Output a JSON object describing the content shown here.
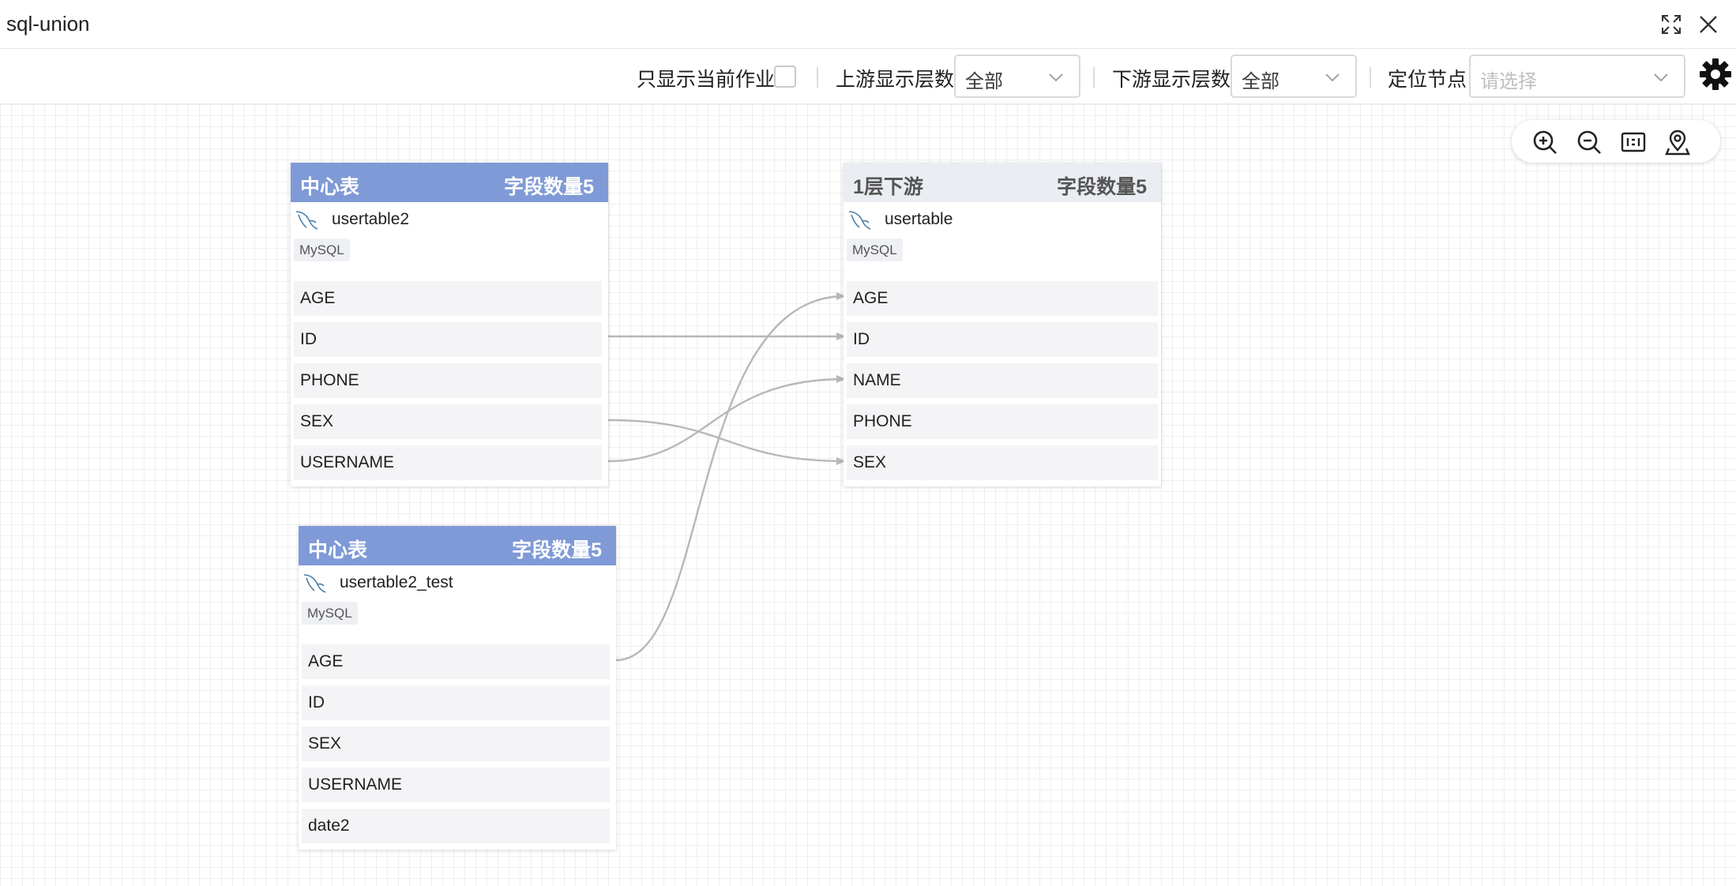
{
  "window": {
    "title": "sql-union"
  },
  "toolbar": {
    "only_current_job_label": "只显示当前作业",
    "upstream_label": "上游显示层数",
    "upstream_value": "全部",
    "downstream_label": "下游显示层数",
    "downstream_value": "全部",
    "locate_label": "定位节点",
    "locate_placeholder": "请选择"
  },
  "nodes": {
    "center1": {
      "type_label": "中心表",
      "count_label": "字段数量5",
      "name": "usertable2",
      "db": "MySQL",
      "fields": [
        "AGE",
        "ID",
        "PHONE",
        "SEX",
        "USERNAME"
      ]
    },
    "center2": {
      "type_label": "中心表",
      "count_label": "字段数量5",
      "name": "usertable2_test",
      "db": "MySQL",
      "fields": [
        "AGE",
        "ID",
        "SEX",
        "USERNAME",
        "date2"
      ]
    },
    "down1": {
      "type_label": "1层下游",
      "count_label": "字段数量5",
      "name": "usertable",
      "db": "MySQL",
      "fields": [
        "AGE",
        "ID",
        "NAME",
        "PHONE",
        "SEX"
      ]
    }
  },
  "icons": {
    "expand": "expand-icon",
    "close": "close-icon",
    "settings": "gear-icon",
    "zoom_in": "zoom-in-icon",
    "zoom_out": "zoom-out-icon",
    "fit": "fit-view-icon",
    "locate": "locate-pin-icon",
    "db": "mysql-dolphin-icon"
  },
  "colors": {
    "center_header": "#7f9ad6",
    "downstream_header": "#eaedf2",
    "edge": "#b8b8b8"
  }
}
